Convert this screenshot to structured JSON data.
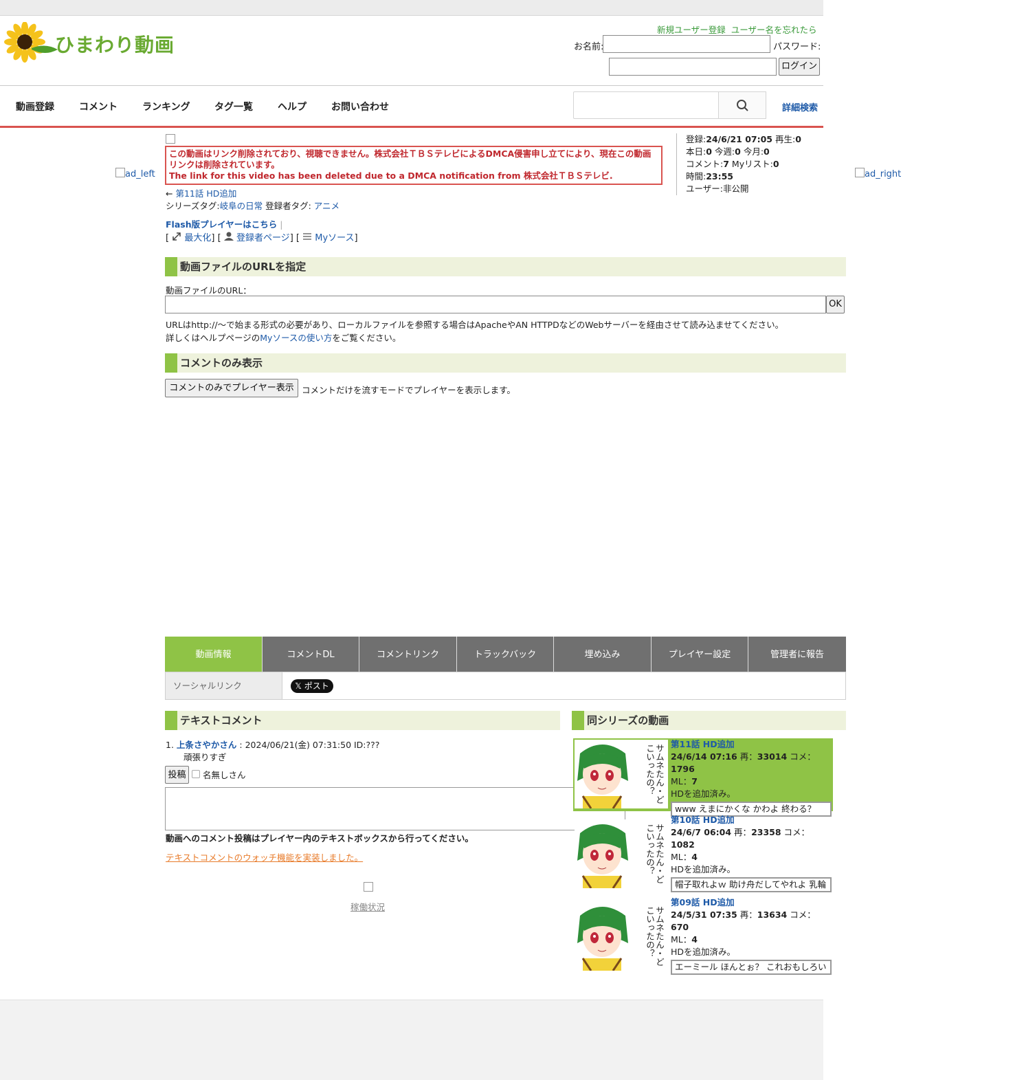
{
  "header": {
    "logo_text": "ひまわり動画",
    "register_link": "新規ユーザー登録",
    "forgot_link": "ユーザー名を忘れたら",
    "name_label": "お名前:",
    "password_label": "パスワード:",
    "login_button": "ログイン"
  },
  "nav": {
    "items": [
      "動画登録",
      "コメント",
      "ランキング",
      "タグ一覧",
      "ヘルプ",
      "お問い合わせ"
    ],
    "advanced_search": "詳細検索"
  },
  "ads": {
    "left": "ad_left",
    "right": "ad_right"
  },
  "notice": {
    "line1": "この動画はリンク削除されており、視聴できません。株式会社ＴＢＳテレビによるDMCA侵害申し立てにより、現在この動画リンクは削除されています。",
    "line2": "The link for this video has been deleted due to a DMCA notification from 株式会社ＴＢＳテレビ."
  },
  "video": {
    "prev_arrow": "←",
    "prev_link": "第11話 HD追加",
    "series_tag_label": "シリーズタグ:",
    "series_tag": "岐阜の日常",
    "user_tag_label": "登録者タグ:",
    "user_tag": "アニメ",
    "flash_link": "Flash版プレイヤーはこちら",
    "maximize": "最大化",
    "uploader_page": "登録者ページ",
    "mysource": "Myソース"
  },
  "stats": {
    "registered_label": "登録:",
    "registered": "24/6/21 07:05",
    "plays_label": "再生:",
    "plays": "0",
    "today_label": "本日:",
    "today": "0",
    "week_label": "今週:",
    "week": "0",
    "month_label": "今月:",
    "month": "0",
    "comments_label": "コメント:",
    "comments": "7",
    "mylist_label": "Myリスト:",
    "mylist": "0",
    "duration_label": "時間:",
    "duration": "23:55",
    "user_label": "ユーザー:",
    "user": "非公開"
  },
  "url_section": {
    "heading": "動画ファイルのURLを指定",
    "field_label": "動画ファイルのURL：",
    "ok_button": "OK",
    "help1": "URLはhttp://～で始まる形式の必要があり、ローカルファイルを参照する場合はApacheやAN HTTPDなどのWebサーバーを経由させて読み込ませてください。",
    "help2_prefix": "詳しくはヘルプページの",
    "help2_link": "Myソースの使い方",
    "help2_suffix": "をご覧ください。"
  },
  "comment_only": {
    "heading": "コメントのみ表示",
    "button": "コメントのみでプレイヤー表示",
    "desc": "コメントだけを流すモードでプレイヤーを表示します。"
  },
  "tabs": [
    "動画情報",
    "コメントDL",
    "コメントリンク",
    "トラックバック",
    "埋め込み",
    "プレイヤー設定",
    "管理者に報告"
  ],
  "social": {
    "label": "ソーシャルリンク",
    "tweet": "𝕏 ポスト"
  },
  "text_comments": {
    "heading": "テキストコメント",
    "entry_no": "1.",
    "entry_user": "上条さやかさん",
    "entry_meta": ": 2024/06/21(金) 07:31:50 ID:???",
    "entry_text": "頑張りすぎ",
    "post_button": "投稿",
    "anon_label": "名無しさん",
    "note": "動画へのコメント投稿はプレイヤー内のテキストボックスから行ってください。",
    "watch_link": "テキストコメントのウォッチ機能を実装しました。",
    "status_link": "稼働状況"
  },
  "series": {
    "heading": "同シリーズの動画",
    "thumb_caption": "サムネたん・どこいったの？",
    "items": [
      {
        "title": "第11話 HD追加",
        "date": "24/6/14 07:16",
        "plays_label": "再：",
        "plays": "33014",
        "comments_label": "コメ：",
        "comments": "1796",
        "ml_label": "ML：",
        "ml": "7",
        "desc": "HDを追加済み。",
        "comment": "www えまにかくな かわよ 終わる？",
        "active": true
      },
      {
        "title": "第10話 HD追加",
        "date": "24/6/7 06:04",
        "plays_label": "再：",
        "plays": "23358",
        "comments_label": "コメ：",
        "comments": "1082",
        "ml_label": "ML：",
        "ml": "4",
        "desc": "HDを追加済み。",
        "comment": "帽子取れよｗ 助け舟だしてやれよ 乳輪",
        "active": false
      },
      {
        "title": "第09話 HD追加",
        "date": "24/5/31 07:35",
        "plays_label": "再：",
        "plays": "13634",
        "comments_label": "コメ：",
        "comments": "670",
        "ml_label": "ML：",
        "ml": "4",
        "desc": "HDを追加済み。",
        "comment": "エーミール ほんとぉ？ これおもしろい",
        "active": false
      }
    ]
  },
  "colors": {
    "accent_green": "#8fc346",
    "nav_red": "#d9534f",
    "link_blue": "#1e5aa8",
    "alert_red": "#c0282e"
  }
}
